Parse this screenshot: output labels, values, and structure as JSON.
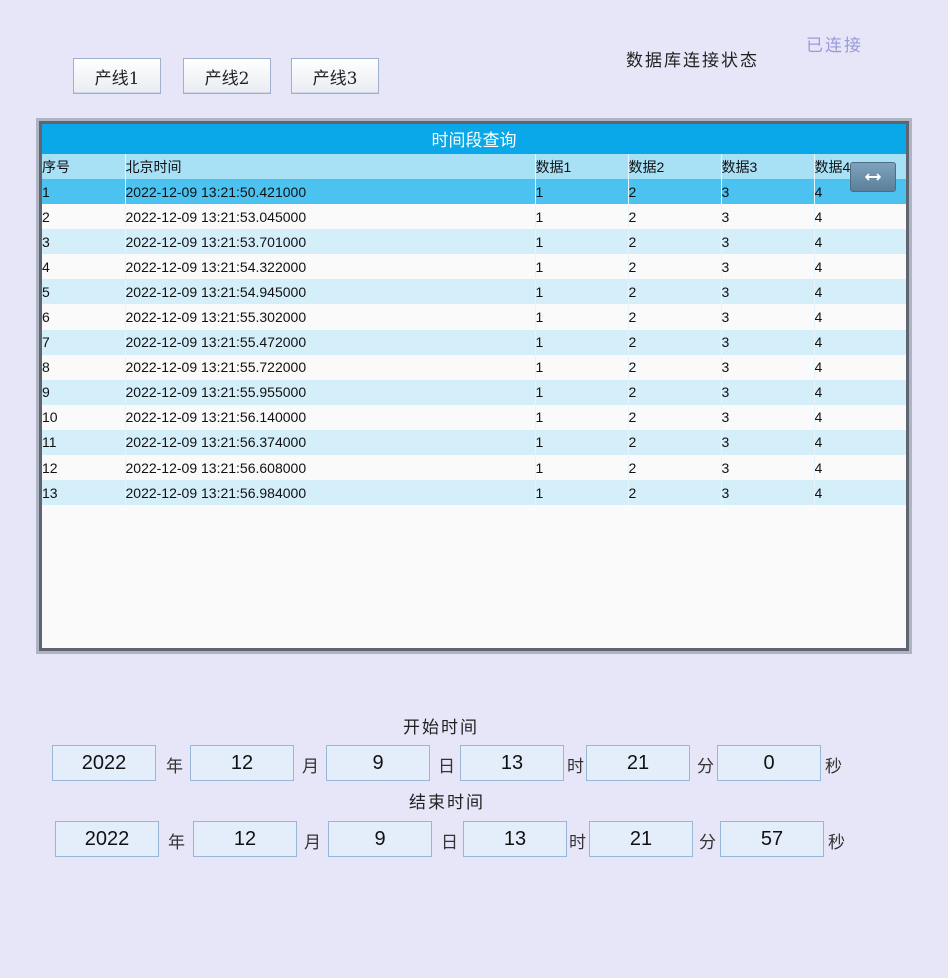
{
  "lines": [
    "产线1",
    "产线2",
    "产线3"
  ],
  "db_status": {
    "label": "数据库连接状态",
    "value": "已连接"
  },
  "grid": {
    "title": "时间段查询",
    "columns": [
      "序号",
      "北京时间",
      "数据1",
      "数据2",
      "数据3",
      "数据4"
    ],
    "rows": [
      [
        "1",
        "2022-12-09 13:21:50.421000",
        "1",
        "2",
        "3",
        "4"
      ],
      [
        "2",
        "2022-12-09 13:21:53.045000",
        "1",
        "2",
        "3",
        "4"
      ],
      [
        "3",
        "2022-12-09 13:21:53.701000",
        "1",
        "2",
        "3",
        "4"
      ],
      [
        "4",
        "2022-12-09 13:21:54.322000",
        "1",
        "2",
        "3",
        "4"
      ],
      [
        "5",
        "2022-12-09 13:21:54.945000",
        "1",
        "2",
        "3",
        "4"
      ],
      [
        "6",
        "2022-12-09 13:21:55.302000",
        "1",
        "2",
        "3",
        "4"
      ],
      [
        "7",
        "2022-12-09 13:21:55.472000",
        "1",
        "2",
        "3",
        "4"
      ],
      [
        "8",
        "2022-12-09 13:21:55.722000",
        "1",
        "2",
        "3",
        "4"
      ],
      [
        "9",
        "2022-12-09 13:21:55.955000",
        "1",
        "2",
        "3",
        "4"
      ],
      [
        "10",
        "2022-12-09 13:21:56.140000",
        "1",
        "2",
        "3",
        "4"
      ],
      [
        "11",
        "2022-12-09 13:21:56.374000",
        "1",
        "2",
        "3",
        "4"
      ],
      [
        "12",
        "2022-12-09 13:21:56.608000",
        "1",
        "2",
        "3",
        "4"
      ],
      [
        "13",
        "2022-12-09 13:21:56.984000",
        "1",
        "2",
        "3",
        "4"
      ]
    ],
    "selected_row": 0,
    "resize_icon": "horizontal-resize-icon"
  },
  "start_time": {
    "label": "开始时间",
    "year": "2022",
    "month": "12",
    "day": "9",
    "hour": "13",
    "minute": "21",
    "second": "0"
  },
  "end_time": {
    "label": "结束时间",
    "year": "2022",
    "month": "12",
    "day": "9",
    "hour": "13",
    "minute": "21",
    "second": "57"
  },
  "units": {
    "year": "年",
    "month": "月",
    "day": "日",
    "hour": "时",
    "minute": "分",
    "second": "秒"
  },
  "colors": {
    "background": "#e6e6f8",
    "title_bar": "#0aa8e8",
    "header": "#a8e0f5",
    "selected_row": "#4cc2f0",
    "alt_row": "#d4eefa",
    "connected": "#9a9ad8"
  }
}
